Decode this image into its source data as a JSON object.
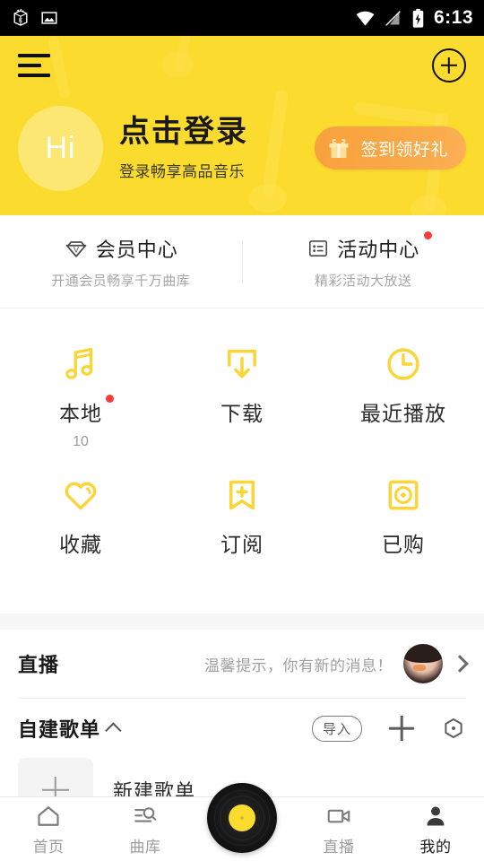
{
  "status_bar": {
    "time": "6:13",
    "left_icons": [
      "app-notification-icon",
      "screenshot-image-icon"
    ],
    "right_icons": [
      "wifi-icon",
      "no-sim-signal-icon",
      "battery-charging-icon"
    ]
  },
  "header": {
    "menu_icon": "hamburger-menu-icon",
    "add_icon": "plus-circle-icon",
    "avatar_text": "Hi",
    "title": "点击登录",
    "subtitle": "登录畅享高品音乐",
    "signin_button": {
      "label": "签到领好礼",
      "icon": "gift-icon",
      "color": "#F9A846"
    },
    "background_color": "#FCDB2F"
  },
  "vip_row": [
    {
      "icon": "vip-diamond-icon",
      "title": "会员中心",
      "subtitle": "开通会员畅享千万曲库",
      "badge": false
    },
    {
      "icon": "activity-list-icon",
      "title": "活动中心",
      "subtitle": "精彩活动大放送",
      "badge": true
    }
  ],
  "grid": [
    {
      "icon": "music-note-icon",
      "label": "本地",
      "count": "10",
      "badge": true
    },
    {
      "icon": "download-icon",
      "label": "下载",
      "count": "",
      "badge": false
    },
    {
      "icon": "clock-icon",
      "label": "最近播放",
      "count": "",
      "badge": false
    },
    {
      "icon": "heart-icon",
      "label": "收藏",
      "count": "",
      "badge": false
    },
    {
      "icon": "bookmark-plus-icon",
      "label": "订阅",
      "count": "",
      "badge": false
    },
    {
      "icon": "disc-square-icon",
      "label": "已购",
      "count": "",
      "badge": false
    }
  ],
  "live_section": {
    "title": "直播",
    "message": "温馨提示，你有新的消息！",
    "avatar": "user-photo-avatar",
    "chevron": "chevron-right-icon"
  },
  "playlist_section": {
    "title": "自建歌单",
    "collapse_icon": "chevron-up-icon",
    "import_label": "导入",
    "add_icon": "plus-icon",
    "manage_icon": "hexagon-dot-icon",
    "new_playlist_label": "新建歌单",
    "new_playlist_thumb_icon": "plus-icon"
  },
  "tabbar": {
    "items": [
      {
        "icon": "home-icon",
        "label": "首页",
        "active": false
      },
      {
        "icon": "library-search-icon",
        "label": "曲库",
        "active": false
      },
      {
        "icon": "vinyl-disc-icon",
        "label": "",
        "active": false
      },
      {
        "icon": "video-camera-icon",
        "label": "直播",
        "active": false
      },
      {
        "icon": "person-icon",
        "label": "我的",
        "active": true
      }
    ]
  },
  "theme": {
    "accent_yellow": "#FCDB2F",
    "icon_yellow": "#FBD436",
    "orange": "#F9A846",
    "red_badge": "#F93B3B",
    "text_dark": "#1a1a1a",
    "text_gray": "#9d9d9d"
  }
}
